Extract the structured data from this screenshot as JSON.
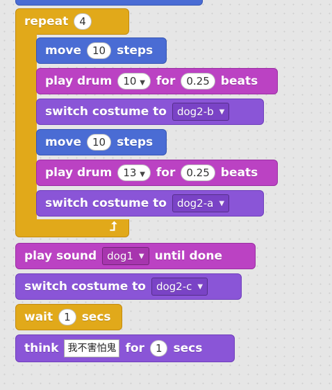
{
  "repeat": {
    "label": "repeat",
    "count": "4"
  },
  "inner": {
    "move1": {
      "label": "move",
      "steps": "10",
      "unit": "steps"
    },
    "drum1": {
      "label": "play drum",
      "drum": "10",
      "for": "for",
      "beats": "0.25",
      "unit": "beats"
    },
    "costume1": {
      "label": "switch costume to",
      "value": "dog2-b"
    },
    "move2": {
      "label": "move",
      "steps": "10",
      "unit": "steps"
    },
    "drum2": {
      "label": "play drum",
      "drum": "13",
      "for": "for",
      "beats": "0.25",
      "unit": "beats"
    },
    "costume2": {
      "label": "switch costume to",
      "value": "dog2-a"
    }
  },
  "sound": {
    "label": "play sound",
    "value": "dog1",
    "suffix": "until done"
  },
  "costume3": {
    "label": "switch costume to",
    "value": "dog2-c"
  },
  "wait": {
    "label": "wait",
    "secs": "1",
    "unit": "secs"
  },
  "think": {
    "label": "think",
    "text": "我不害怕鬼",
    "for": "for",
    "secs": "1",
    "unit": "secs"
  },
  "colors": {
    "motion": "#4a6cd4",
    "sound": "#bb42c3",
    "looks": "#8a55d7",
    "control": "#e1a91a",
    "workspace": "#e6e6e6"
  },
  "icons": {
    "dropdown": "triangle-down-icon",
    "loop": "loop-arrow-icon"
  }
}
